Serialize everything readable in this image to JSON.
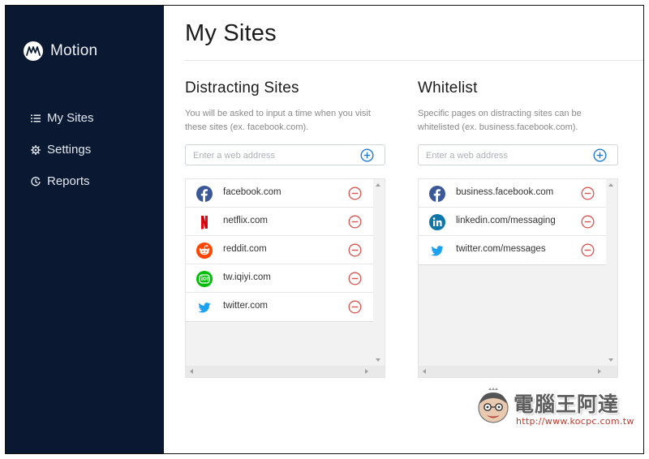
{
  "app": {
    "name": "Motion",
    "logo_text": "M"
  },
  "nav": {
    "items": [
      {
        "label": "My Sites",
        "icon": "list-icon"
      },
      {
        "label": "Settings",
        "icon": "gear-icon"
      },
      {
        "label": "Reports",
        "icon": "clock-icon"
      }
    ]
  },
  "page": {
    "title": "My Sites"
  },
  "distracting": {
    "title": "Distracting Sites",
    "description": "You will be asked to input a time when you visit these sites (ex. facebook.com).",
    "placeholder": "Enter a web address",
    "sites": [
      {
        "name": "facebook.com",
        "icon": "facebook-icon"
      },
      {
        "name": "netflix.com",
        "icon": "netflix-icon"
      },
      {
        "name": "reddit.com",
        "icon": "reddit-icon"
      },
      {
        "name": "tw.iqiyi.com",
        "icon": "iqiyi-icon"
      },
      {
        "name": "twitter.com",
        "icon": "twitter-icon"
      }
    ]
  },
  "whitelist": {
    "title": "Whitelist",
    "description": "Specific pages on distracting sites can be whitelisted (ex. business.facebook.com).",
    "placeholder": "Enter a web address",
    "sites": [
      {
        "name": "business.facebook.com",
        "icon": "facebook-icon"
      },
      {
        "name": "linkedin.com/messaging",
        "icon": "linkedin-icon"
      },
      {
        "name": "twitter.com/messages",
        "icon": "twitter-icon"
      }
    ]
  },
  "watermark": {
    "title": "電腦王阿達",
    "url": "http://www.kocpc.com.tw"
  },
  "colors": {
    "sidebar": "#0a1931",
    "accent_add": "#1f7ad6",
    "remove": "#d9534f",
    "facebook": "#3b5998",
    "netflix": "#e50914",
    "reddit": "#ff4500",
    "iqiyi": "#00be06",
    "twitter": "#1da1f2",
    "linkedin": "#0e76a8"
  }
}
